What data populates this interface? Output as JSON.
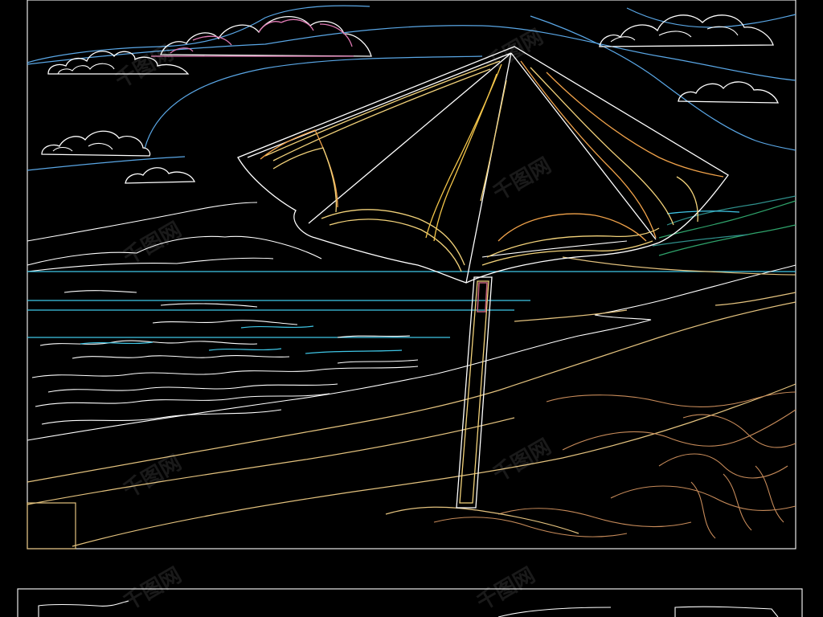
{
  "artwork": {
    "subject": "beach with umbrella",
    "style": "CAD line drawing on black background",
    "colors": {
      "background": "#000000",
      "frame": "#ffffff",
      "sky_line": "#5aa7e6",
      "sea_line": "#3fc6e6",
      "cloud_accent": "#e07ab4",
      "umbrella": "#f2d27a",
      "sand": "#e3c27e",
      "vegetation": "#2fa36b"
    }
  },
  "watermark": {
    "text": "千图网"
  }
}
